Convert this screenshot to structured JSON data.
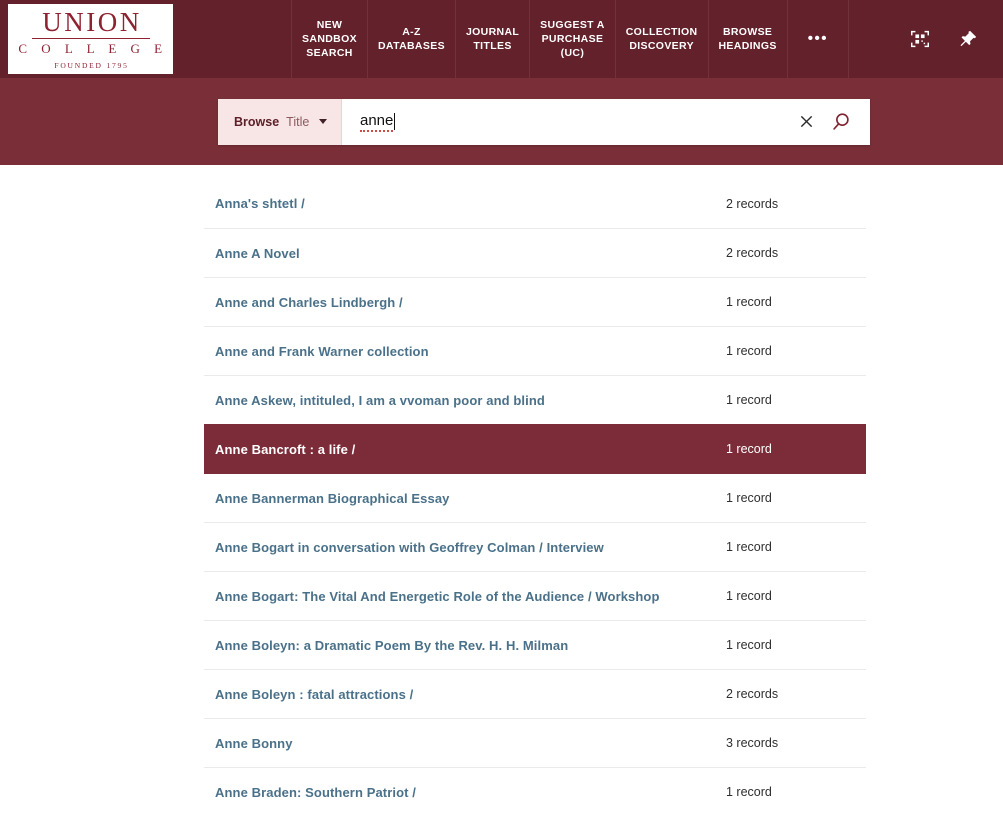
{
  "brand": {
    "name": "UNION",
    "subname": "C O L L E G E",
    "founded": "FOUNDED 1795",
    "nav_bg": "#62212b",
    "band_bg": "#7a2f38",
    "selected_bg": "#7c2c38",
    "link_color": "#4a7189"
  },
  "nav": {
    "items": [
      {
        "label": "NEW\nSANDBOX\nSEARCH",
        "name": "nav-item-new-sandbox-search"
      },
      {
        "label": "A-Z\nDATABASES",
        "name": "nav-item-a-z-databases"
      },
      {
        "label": "JOURNAL\nTITLES",
        "name": "nav-item-journal-titles"
      },
      {
        "label": "SUGGEST A\nPURCHASE\n(UC)",
        "name": "nav-item-suggest-a-purchase"
      },
      {
        "label": "COLLECTION\nDISCOVERY",
        "name": "nav-item-collection-discovery"
      },
      {
        "label": "BROWSE\nHEADINGS",
        "name": "nav-item-browse-headings"
      },
      {
        "label": "•••",
        "name": "nav-item-more"
      }
    ],
    "icons": [
      {
        "label": "qr-scan-icon"
      },
      {
        "label": "pin-icon"
      }
    ]
  },
  "search": {
    "scope_prefix": "Browse",
    "scope_value": "Title",
    "query": "anne",
    "placeholder": "",
    "clear_label": "×",
    "search_label": "search"
  },
  "results": {
    "count_unit_singular": "1 record",
    "count_unit_plural": "records",
    "rows": [
      {
        "title": "Anna's shtetl /",
        "count": "2 records",
        "selected": false
      },
      {
        "title": "Anne A Novel",
        "count": "2 records",
        "selected": false
      },
      {
        "title": "Anne and Charles Lindbergh /",
        "count": "1 record",
        "selected": false
      },
      {
        "title": "Anne and Frank Warner collection",
        "count": "1 record",
        "selected": false
      },
      {
        "title": "Anne Askew, intituled, I am a vvoman poor and blind",
        "count": "1 record",
        "selected": false
      },
      {
        "title": "Anne Bancroft : a life /",
        "count": "1 record",
        "selected": true
      },
      {
        "title": "Anne Bannerman Biographical Essay",
        "count": "1 record",
        "selected": false
      },
      {
        "title": "Anne Bogart in conversation with Geoffrey Colman / Interview",
        "count": "1 record",
        "selected": false
      },
      {
        "title": "Anne Bogart: The Vital And Energetic Role of the Audience / Workshop",
        "count": "1 record",
        "selected": false
      },
      {
        "title": "Anne Boleyn: a Dramatic Poem By the Rev. H. H. Milman",
        "count": "1 record",
        "selected": false
      },
      {
        "title": "Anne Boleyn : fatal attractions /",
        "count": "2 records",
        "selected": false
      },
      {
        "title": "Anne Bonny",
        "count": "3 records",
        "selected": false
      },
      {
        "title": "Anne Braden: Southern Patriot /",
        "count": "1 record",
        "selected": false
      }
    ]
  }
}
